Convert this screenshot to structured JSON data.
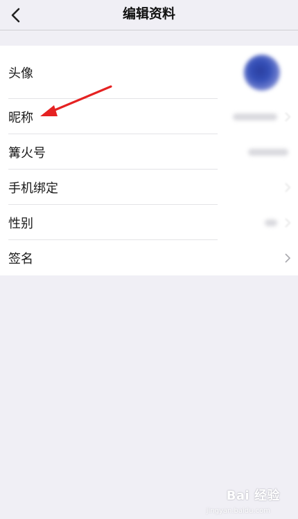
{
  "navbar": {
    "title": "编辑资料",
    "back_icon": "chevron-left-icon"
  },
  "rows": [
    {
      "label": "头像"
    },
    {
      "label": "昵称"
    },
    {
      "label": "篝火号"
    },
    {
      "label": "手机绑定"
    },
    {
      "label": "性别"
    },
    {
      "label": "签名"
    }
  ],
  "annotation": {
    "arrow_color": "#e52222"
  },
  "watermark": {
    "text": "Bai 经验",
    "sub": "jingyan.baidu.com"
  },
  "colors": {
    "background": "#f0eff5",
    "list": "#ffffff",
    "separator": "#e3e3e6"
  }
}
